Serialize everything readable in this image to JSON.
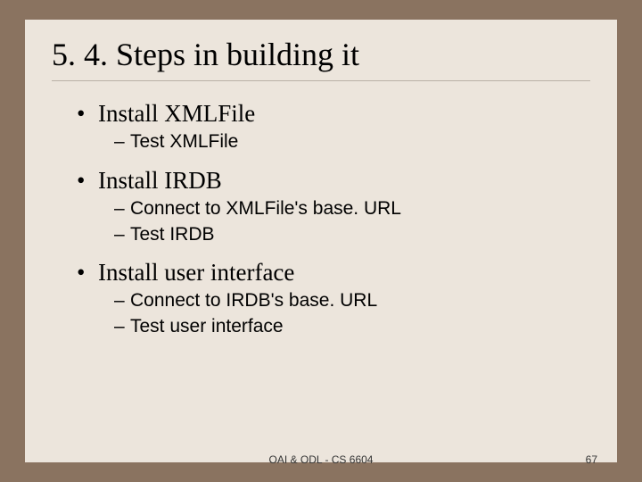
{
  "title": "5. 4. Steps in building it",
  "bullets": {
    "b0": "Install XMLFile",
    "b0_0": "Test XMLFile",
    "b1": "Install IRDB",
    "b1_0": "Connect to XMLFile's base. URL",
    "b1_1": "Test IRDB",
    "b2": "Install user interface",
    "b2_0": "Connect to IRDB's base. URL",
    "b2_1": "Test user interface"
  },
  "footer": {
    "center": "OAI & ODL - CS 6604",
    "page": "67"
  }
}
